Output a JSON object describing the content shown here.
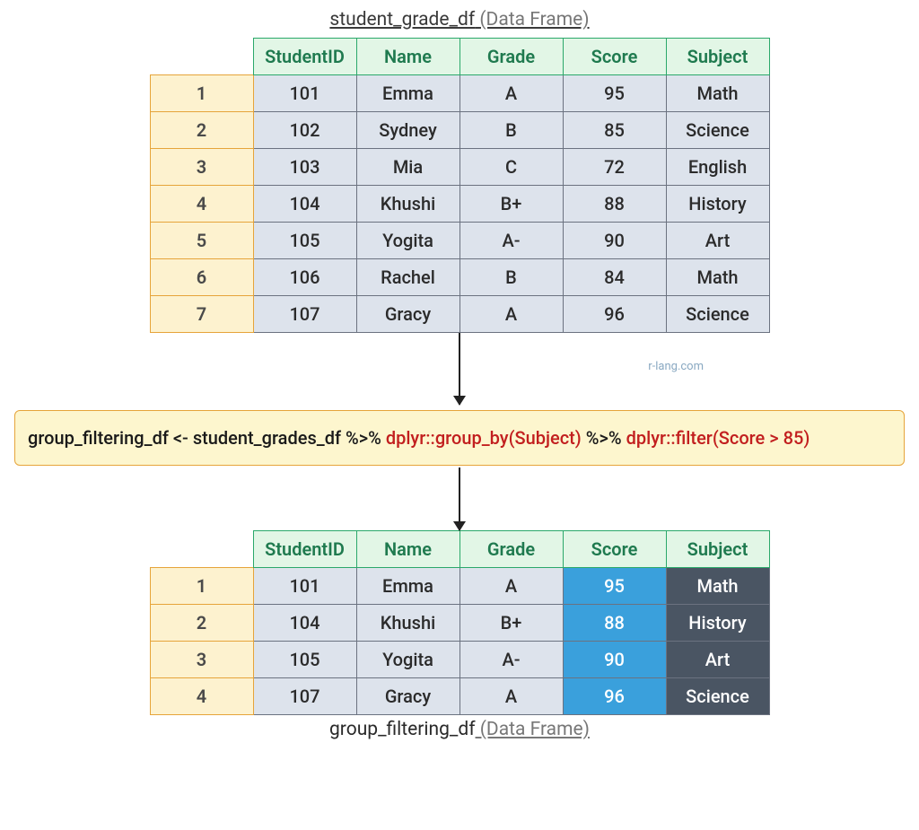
{
  "topTitle": {
    "name": "student_grade_df",
    "annot": " (Data Frame)"
  },
  "bottomTitle": {
    "name": "group_filtering_df",
    "annot": " (Data Frame)"
  },
  "watermark": "r-lang.com",
  "headers": [
    "StudentID",
    "Name",
    "Grade",
    "Score",
    "Subject"
  ],
  "inputRows": [
    {
      "idx": "1",
      "StudentID": "101",
      "Name": "Emma",
      "Grade": "A",
      "Score": "95",
      "Subject": "Math"
    },
    {
      "idx": "2",
      "StudentID": "102",
      "Name": "Sydney",
      "Grade": "B",
      "Score": "85",
      "Subject": "Science"
    },
    {
      "idx": "3",
      "StudentID": "103",
      "Name": "Mia",
      "Grade": "C",
      "Score": "72",
      "Subject": "English"
    },
    {
      "idx": "4",
      "StudentID": "104",
      "Name": "Khushi",
      "Grade": "B+",
      "Score": "88",
      "Subject": "History"
    },
    {
      "idx": "5",
      "StudentID": "105",
      "Name": "Yogita",
      "Grade": "A-",
      "Score": "90",
      "Subject": "Art"
    },
    {
      "idx": "6",
      "StudentID": "106",
      "Name": "Rachel",
      "Grade": "B",
      "Score": "84",
      "Subject": "Math"
    },
    {
      "idx": "7",
      "StudentID": "107",
      "Name": "Gracy",
      "Grade": "A",
      "Score": "96",
      "Subject": "Science"
    }
  ],
  "outputRows": [
    {
      "idx": "1",
      "StudentID": "101",
      "Name": "Emma",
      "Grade": "A",
      "Score": "95",
      "Subject": "Math"
    },
    {
      "idx": "2",
      "StudentID": "104",
      "Name": "Khushi",
      "Grade": "B+",
      "Score": "88",
      "Subject": "History"
    },
    {
      "idx": "3",
      "StudentID": "105",
      "Name": "Yogita",
      "Grade": "A-",
      "Score": "90",
      "Subject": "Art"
    },
    {
      "idx": "4",
      "StudentID": "107",
      "Name": "Gracy",
      "Grade": "A",
      "Score": "96",
      "Subject": "Science"
    }
  ],
  "code": {
    "lhs": "group_filtering_df <- student_grades_df ",
    "pipe1": "%>%",
    "red1": " dplyr::group_by(Subject) ",
    "pipe2": "%>%",
    "red2": " dplyr::filter(Score > 85)"
  }
}
